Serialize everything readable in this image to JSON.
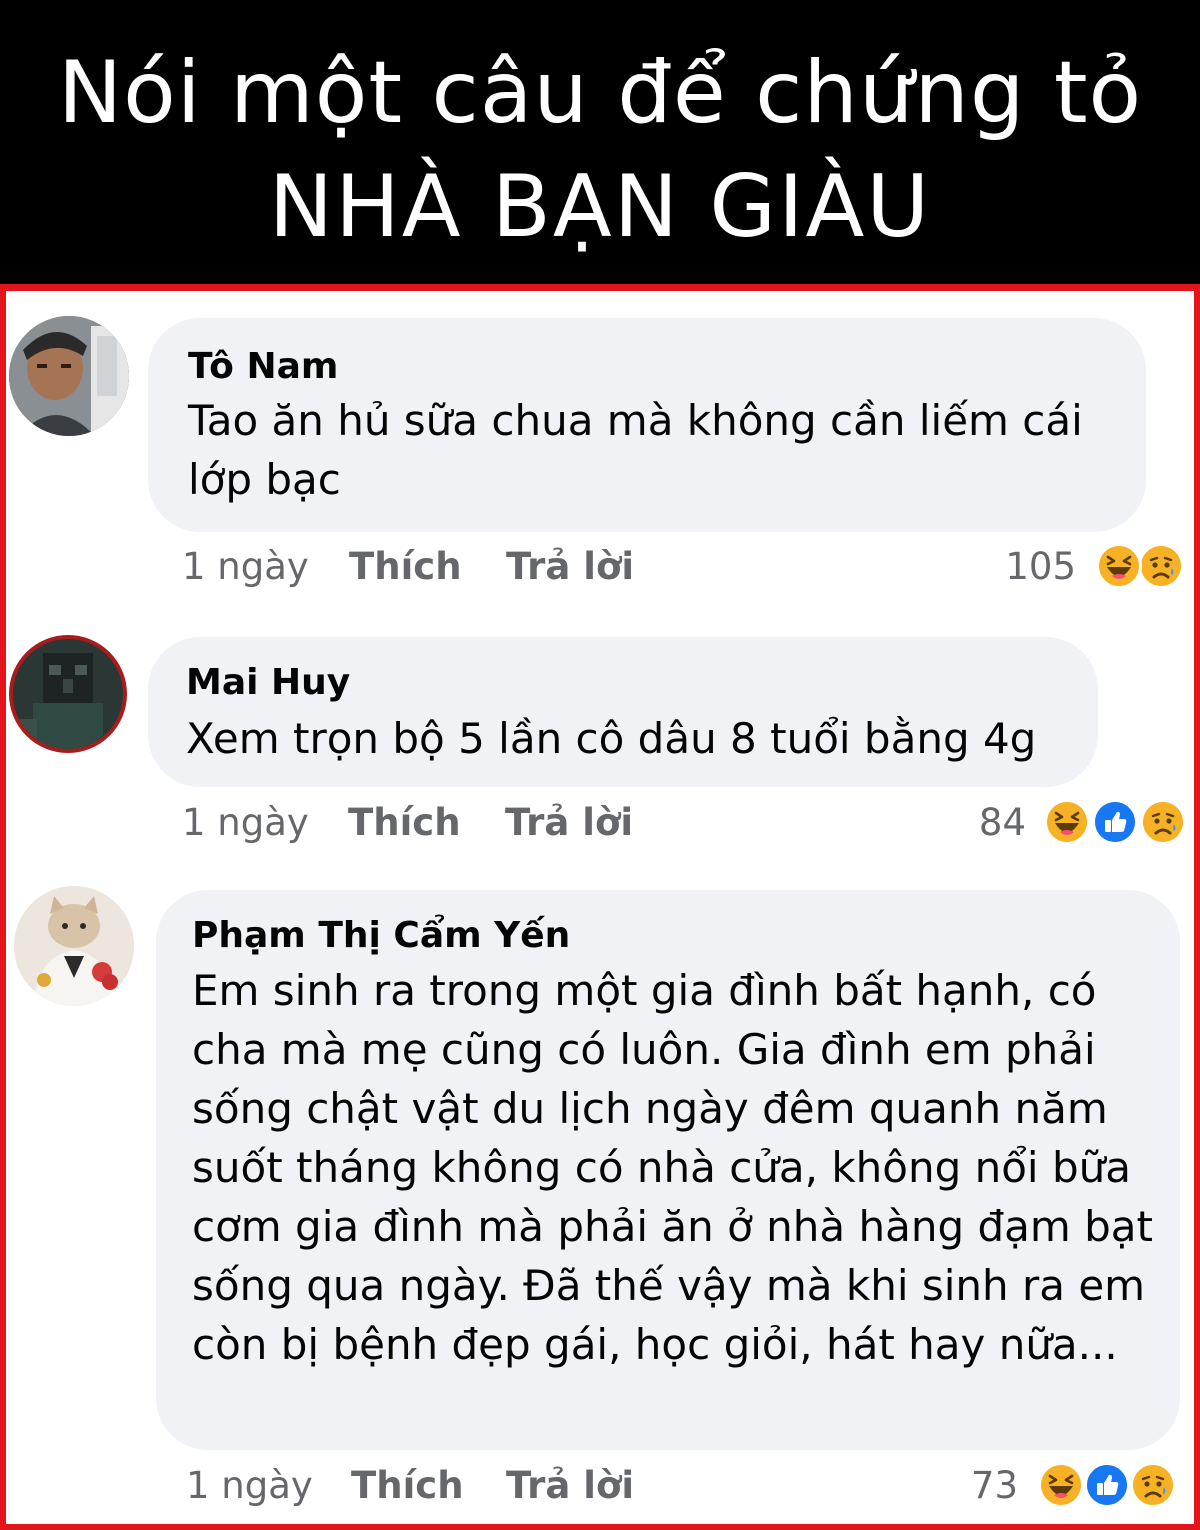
{
  "banner": {
    "line1": "Nói một câu để chứng tỏ",
    "line2": "NHÀ BẠN GIÀU"
  },
  "colors": {
    "banner_bg": "#000000",
    "frame_border": "#e3141b",
    "bubble_bg": "#f0f2f5",
    "meta_text": "#65676b"
  },
  "comments": [
    {
      "author": "Tô Nam",
      "text": "Tao ăn hủ sữa chua mà không cần liếm cái lớp bạc",
      "time": "1 ngày",
      "like": "Thích",
      "reply": "Trả lời",
      "reaction_count": "105",
      "reactions": [
        "haha-icon",
        "sad-icon"
      ]
    },
    {
      "author": "Mai Huy",
      "text": "Xem trọn bộ 5 lần cô dâu 8 tuổi bằng 4g",
      "time": "1 ngày",
      "like": "Thích",
      "reply": "Trả lời",
      "reaction_count": "84",
      "reactions": [
        "haha-icon",
        "like-icon",
        "sad-icon"
      ]
    },
    {
      "author": "Phạm Thị Cẩm Yến",
      "text": "Em sinh ra trong một gia đình bất hạnh, có cha mà mẹ cũng có luôn. Gia đình em phải sống chật vật du lịch ngày đêm quanh năm suốt tháng không có nhà cửa, không nổi bữa cơm gia đình mà phải ăn ở nhà hàng đạm bạt sống qua ngày. Đã thế vậy mà khi sinh ra em còn bị bệnh đẹp gái, học giỏi, hát hay nữa...",
      "time": "1 ngày",
      "like": "Thích",
      "reply": "Trả lời",
      "reaction_count": "73",
      "reactions": [
        "haha-icon",
        "like-icon",
        "sad-icon"
      ]
    }
  ]
}
